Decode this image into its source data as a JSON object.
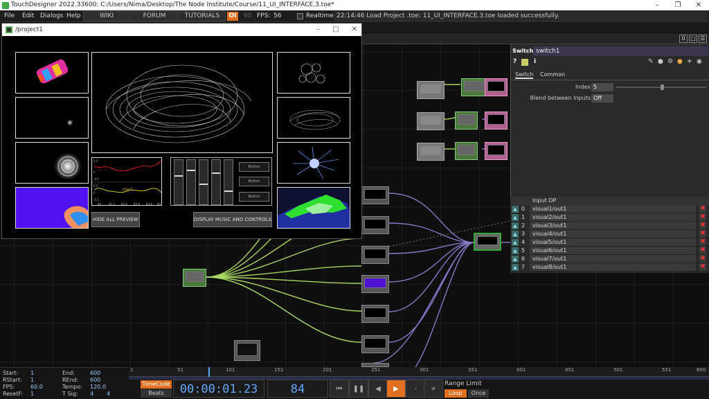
{
  "app": {
    "title": "TouchDesigner 2022.33600: C:/Users/Nima/Desktop/The Node Institute/Course/11_UI_INTERFACE.3.toe*"
  },
  "menu": {
    "file": "File",
    "edit": "Edit",
    "dialogs": "Dialogs",
    "help": "Help",
    "wiki": "WIKI",
    "forum": "FORUM",
    "tutorials": "TUTORIALS",
    "ol": "OI",
    "sixty": "60",
    "fps_label": "FPS:",
    "fps": "56",
    "realtime": "Realtime",
    "log": "22:14:46 Load Project .toe: 11_UI_INTERFACE.3.toe loaded successfully."
  },
  "pane": {
    "zero": "0"
  },
  "project": {
    "title": "/project1",
    "hide_btn": "HIDE ALL PREVIEW",
    "display_btn": "DISPLAY MUSIC AND CONTROLS",
    "button_label": "Button",
    "chart_label": "chan1",
    "chart_ticks": [
      "83",
      "83.2",
      "83.4",
      "83.6",
      "83.8",
      "84"
    ],
    "chart_yticks": [
      "0.5",
      "0",
      "-0.5",
      "0.5",
      "0",
      "-0.5"
    ]
  },
  "param": {
    "type": "Switch",
    "name": "switch1",
    "tab_switch": "Switch",
    "tab_common": "Common",
    "index_label": "Index",
    "index_value": "5",
    "blend_label": "Blend between Inputs",
    "blend_value": "Off",
    "input_header": "Input OP"
  },
  "inputs": [
    {
      "n": "0",
      "v": "visual1/out1"
    },
    {
      "n": "1",
      "v": "visual2/out1"
    },
    {
      "n": "2",
      "v": "visual3/out1"
    },
    {
      "n": "3",
      "v": "visual4/out1"
    },
    {
      "n": "4",
      "v": "visual5/out1"
    },
    {
      "n": "5",
      "v": "visual6/out1"
    },
    {
      "n": "6",
      "v": "visual7/out1"
    },
    {
      "n": "7",
      "v": "visual8/out1"
    }
  ],
  "timeline": {
    "ticks": [
      "1",
      "51",
      "101",
      "151",
      "201",
      "251",
      "301",
      "351",
      "401",
      "451",
      "501",
      "551",
      "600"
    ]
  },
  "bottom": {
    "start_l": "Start:",
    "start": "1",
    "end_l": "End:",
    "end": "600",
    "rstart_l": "RStart:",
    "rstart": "1",
    "rend_l": "REnd:",
    "rend": "600",
    "fps_l": "FPS:",
    "fps": "60.0",
    "tempo_l": "Tempo:",
    "tempo": "120.0",
    "resetf_l": "ResetF:",
    "resetf": "1",
    "tsig_l": "T Sig:",
    "tsig_a": "4",
    "tsig_b": "4",
    "timecode": "TimeCode",
    "beats": "Beats",
    "time": "00:00:01.23",
    "frame": "84",
    "range": "Range Limit",
    "loop": "Loop",
    "once": "Once"
  },
  "colors": {
    "accent": "#e07020",
    "wire_green": "#a8d860",
    "wire_purple": "#8878c8",
    "select": "#3a3"
  }
}
